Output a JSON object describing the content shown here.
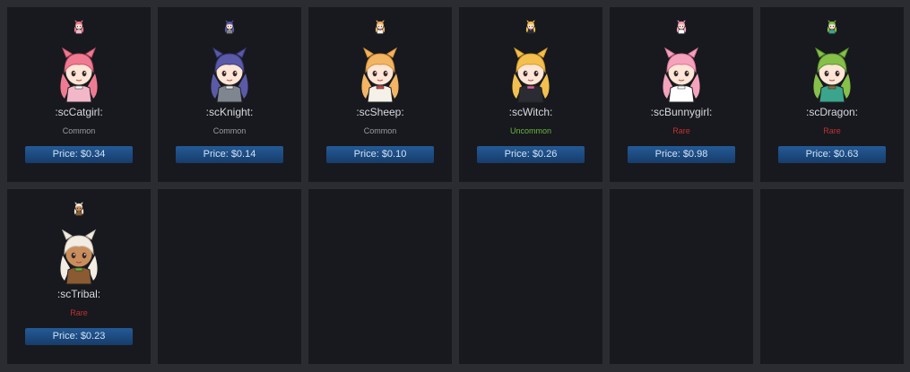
{
  "items": [
    {
      "name": ":scCatgirl:",
      "rarity": "Common",
      "rarity_color": "#9a9ca0",
      "price_label": "Price: $0.34",
      "hair": "#ef7b93",
      "hair_dark": "#c9506a",
      "skin": "#ffe6d6",
      "outfit": "#f2b7c9",
      "accent": "#ffffff"
    },
    {
      "name": ":scKnight:",
      "rarity": "Common",
      "rarity_color": "#9a9ca0",
      "price_label": "Price: $0.14",
      "hair": "#5a5aa8",
      "hair_dark": "#3a3a7a",
      "skin": "#ffe6d6",
      "outfit": "#7f8690",
      "accent": "#e8e8e8"
    },
    {
      "name": ":scSheep:",
      "rarity": "Common",
      "rarity_color": "#9a9ca0",
      "price_label": "Price: $0.10",
      "hair": "#f2b564",
      "hair_dark": "#d58e3a",
      "skin": "#ffe6d6",
      "outfit": "#f5f1e8",
      "accent": "#d44a4a"
    },
    {
      "name": ":scWitch:",
      "rarity": "Uncommon",
      "rarity_color": "#6bb53f",
      "price_label": "Price: $0.26",
      "hair": "#f3c04f",
      "hair_dark": "#d49a2b",
      "skin": "#ffe6d6",
      "outfit": "#2b2b33",
      "accent": "#e15fa0"
    },
    {
      "name": ":scBunnygirl:",
      "rarity": "Rare",
      "rarity_color": "#c0312f",
      "price_label": "Price: $0.98",
      "hair": "#f5a2bd",
      "hair_dark": "#d97595",
      "skin": "#ffe6d6",
      "outfit": "#ffffff",
      "accent": "#ffffff"
    },
    {
      "name": ":scDragon:",
      "rarity": "Rare",
      "rarity_color": "#c0312f",
      "price_label": "Price: $0.63",
      "hair": "#86c04a",
      "hair_dark": "#5b8f2c",
      "skin": "#ffe6d6",
      "outfit": "#3aa58c",
      "accent": "#9b6a3a"
    },
    {
      "name": ":scTribal:",
      "rarity": "Rare",
      "rarity_color": "#c0312f",
      "price_label": "Price: $0.23",
      "hair": "#f3ece2",
      "hair_dark": "#c9bfb2",
      "skin": "#c98e5c",
      "outfit": "#8a5a32",
      "accent": "#6bb53f"
    }
  ],
  "empty_slots": 5
}
